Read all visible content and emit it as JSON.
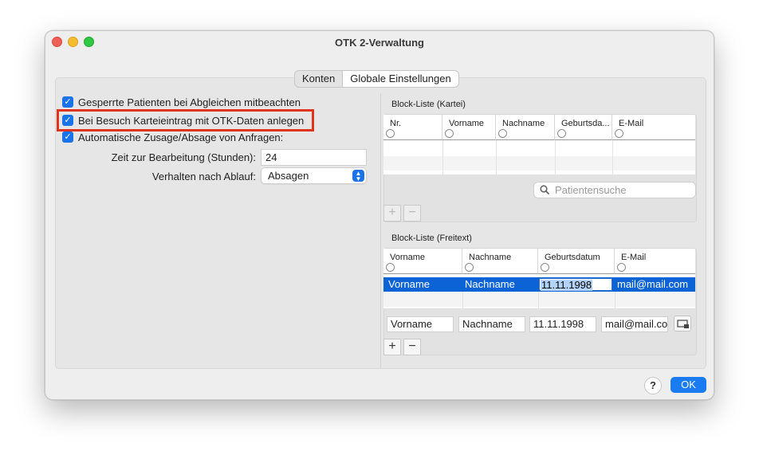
{
  "window": {
    "title": "OTK 2-Verwaltung"
  },
  "tabs": [
    {
      "label": "Konten",
      "active": false
    },
    {
      "label": "Globale Einstellungen",
      "active": true
    }
  ],
  "left": {
    "checkboxes": [
      {
        "label": "Gesperrte Patienten bei Abgleichen mitbeachten",
        "checked": true
      },
      {
        "label": "Bei Besuch Karteieintrag mit OTK-Daten anlegen",
        "checked": true,
        "highlighted": true
      },
      {
        "label": "Automatische Zusage/Absage von Anfragen:",
        "checked": true
      }
    ],
    "time_label": "Zeit zur Bearbeitung (Stunden):",
    "time_value": "24",
    "after_label": "Verhalten nach Ablauf:",
    "after_value": "Absagen"
  },
  "kartei": {
    "title": "Block-Liste (Kartei)",
    "columns": [
      "Nr.",
      "Vorname",
      "Nachname",
      "Geburtsda...",
      "E-Mail"
    ],
    "search_placeholder": "Patientensuche",
    "add": "+",
    "remove": "−"
  },
  "freitext": {
    "title": "Block-Liste (Freitext)",
    "columns": [
      "Vorname",
      "Nachname",
      "Geburtsdatum",
      "E-Mail"
    ],
    "rows": [
      {
        "vorname": "Vorname",
        "nachname": "Nachname",
        "geburtsdatum": "11.11.1998",
        "email": "mail@mail.com",
        "selected": true
      }
    ],
    "inputs": {
      "vorname": "Vorname",
      "nachname": "Nachname",
      "geburtsdatum": "11.11.1998",
      "email": "mail@mail.co"
    },
    "add": "+",
    "remove": "−"
  },
  "footer": {
    "help": "?",
    "ok": "OK"
  },
  "colors": {
    "accent": "#1a73e8",
    "selection": "#0b63d6",
    "highlight": "#e0341f"
  }
}
